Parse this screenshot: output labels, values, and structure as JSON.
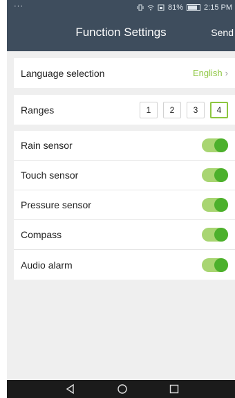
{
  "status_bar": {
    "left_text": "···",
    "battery_percent": "81%",
    "battery_level": 0.81,
    "time": "2:15 PM"
  },
  "header": {
    "title": "Function Settings",
    "send_label": "Send"
  },
  "language": {
    "label": "Language selection",
    "value": "English"
  },
  "ranges": {
    "label": "Ranges",
    "options": [
      "1",
      "2",
      "3",
      "4"
    ],
    "selected": "4"
  },
  "sensors": [
    {
      "label": "Rain sensor",
      "on": true
    },
    {
      "label": "Touch sensor",
      "on": true
    },
    {
      "label": "Pressure sensor",
      "on": true
    },
    {
      "label": "Compass",
      "on": true
    },
    {
      "label": "Audio alarm",
      "on": true
    }
  ],
  "colors": {
    "header_bg": "#3e4d5d",
    "accent_green": "#8dc63f",
    "toggle_track": "#a8d572",
    "toggle_knob": "#4cb02c"
  },
  "icons": {
    "nav": [
      "back-icon",
      "home-icon",
      "recent-apps-icon"
    ]
  }
}
